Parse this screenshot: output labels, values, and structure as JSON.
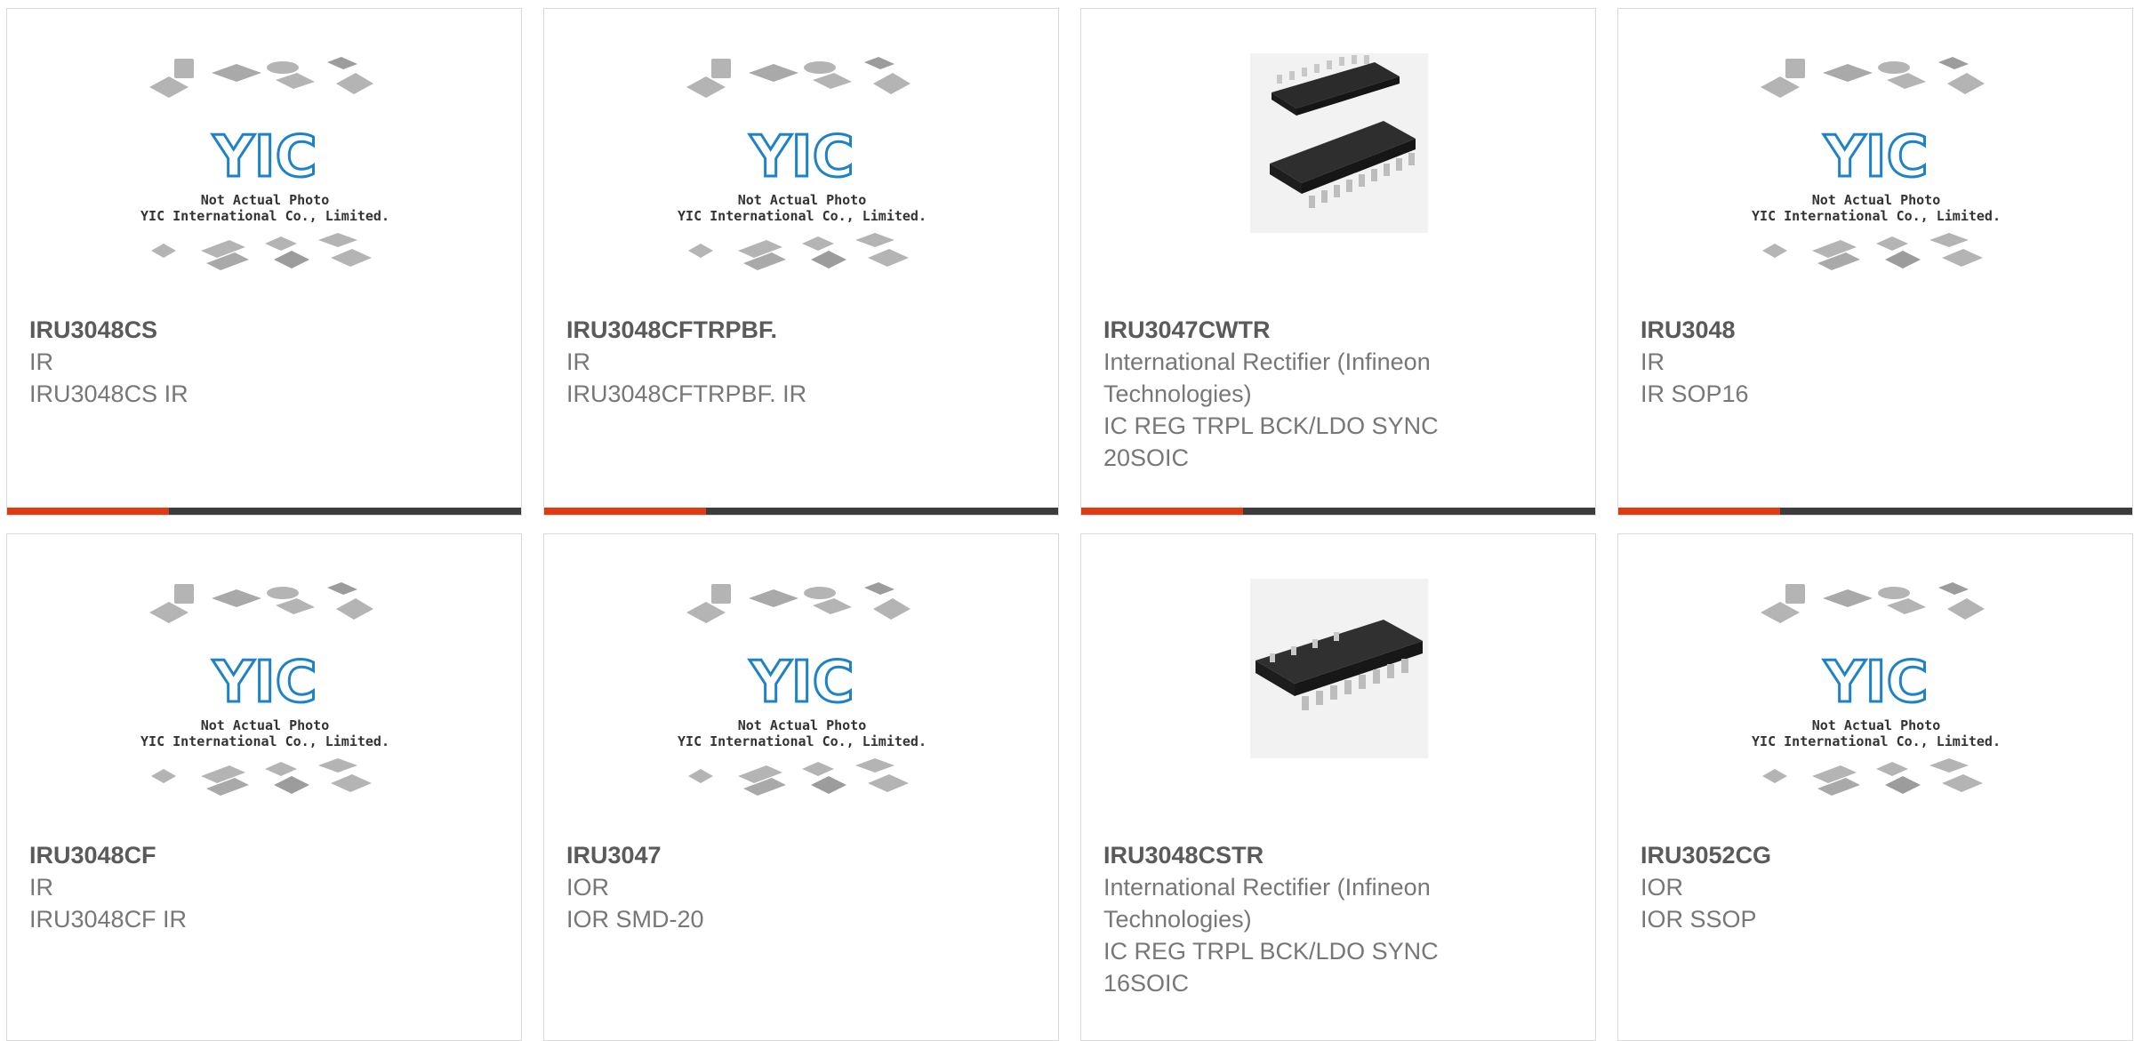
{
  "colors": {
    "accent": "#e03a12",
    "bar_dark": "#3c3c3c",
    "part_number": "#5a5a5a",
    "text_muted": "#777777",
    "logo_blue": "#1e82c8"
  },
  "placeholder": {
    "line1": "Not Actual Photo",
    "line2": "YIC International Co., Limited.",
    "logo_text": "YIC"
  },
  "products": [
    {
      "part_number": "IRU3048CS",
      "manufacturer": "IR",
      "description": "IRU3048CS IR",
      "image": "placeholder",
      "show_bar": true
    },
    {
      "part_number": "IRU3048CFTRPBF.",
      "manufacturer": "IR",
      "description": "IRU3048CFTRPBF. IR",
      "image": "placeholder",
      "show_bar": true
    },
    {
      "part_number": "IRU3047CWTR",
      "manufacturer": "International Rectifier (Infineon Technologies)",
      "description": "IC REG TRPL BCK/LDO SYNC 20SOIC",
      "image": "soic-20-photo",
      "show_bar": true
    },
    {
      "part_number": "IRU3048",
      "manufacturer": "IR",
      "description": "IR SOP16",
      "image": "placeholder",
      "show_bar": true
    },
    {
      "part_number": "IRU3048CF",
      "manufacturer": "IR",
      "description": "IRU3048CF IR",
      "image": "placeholder",
      "show_bar": false
    },
    {
      "part_number": "IRU3047",
      "manufacturer": "IOR",
      "description": "IOR SMD-20",
      "image": "placeholder",
      "show_bar": false
    },
    {
      "part_number": "IRU3048CSTR",
      "manufacturer": "International Rectifier (Infineon Technologies)",
      "description": "IC REG TRPL BCK/LDO SYNC 16SOIC",
      "image": "soic-16-photo",
      "show_bar": false
    },
    {
      "part_number": "IRU3052CG",
      "manufacturer": "IOR",
      "description": "IOR SSOP",
      "image": "placeholder",
      "show_bar": false
    }
  ]
}
